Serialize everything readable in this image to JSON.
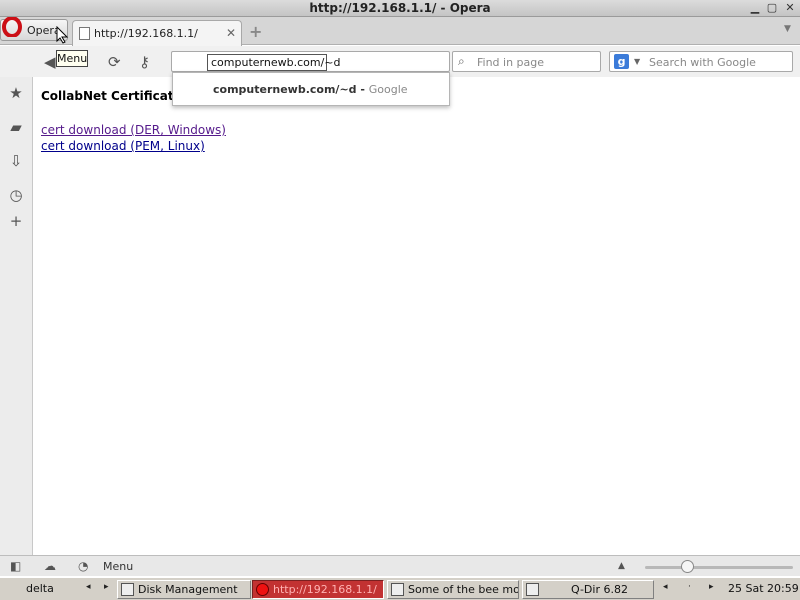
{
  "window": {
    "title": "http://192.168.1.1/ - Opera",
    "min_glyph": "▁",
    "max_glyph": "▢",
    "close_glyph": "✕"
  },
  "tabbar": {
    "opera_label": "Opera",
    "tooltip": "Menu",
    "tab_label": "http://192.168.1.1/",
    "tab_close": "✕",
    "new_tab": "+",
    "tab_menu": "▼"
  },
  "navbar": {
    "address_value": "computernewb.com/~d",
    "find_placeholder": "Find in page",
    "search_placeholder": "Search with Google",
    "search_engine_icon": "g"
  },
  "suggestion": {
    "bold": "computernewb.com/~d",
    "sep": " - ",
    "source": "Google"
  },
  "page": {
    "heading": "CollabNet Certificate",
    "links": [
      "cert download (DER, Windows)",
      "cert download (PEM, Linux)"
    ]
  },
  "statusbar": {
    "menu_label": "Menu",
    "zoom_level": 0.26
  },
  "taskbar": {
    "workspace": "delta",
    "items": [
      "Disk Management",
      "http://192.168.1.1/",
      "Some of the bee mo...",
      "Q-Dir 6.82"
    ],
    "clock": "25 Sat 20:59"
  },
  "colors": {
    "visited_link": "#551a8b",
    "link": "#00008b",
    "opera_red": "#cc0f16",
    "active_task": "#c23232"
  }
}
